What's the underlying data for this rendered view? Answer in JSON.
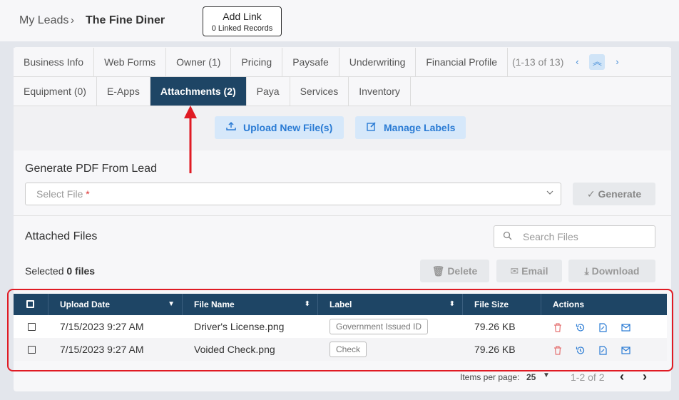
{
  "breadcrumb": {
    "root": "My Leads",
    "separator": "›",
    "current": "The Fine Diner"
  },
  "add_link": {
    "label": "Add Link",
    "sub": "0 Linked Records"
  },
  "tabs_row1": [
    "Business Info",
    "Web Forms",
    "Owner (1)",
    "Pricing",
    "Paysafe",
    "Underwriting",
    "Financial Profile"
  ],
  "tab_pager": {
    "count": "(1-13 of 13)",
    "prev": "‹",
    "collapse": "︽",
    "next": "›"
  },
  "tabs_row2": [
    "Equipment (0)",
    "E-Apps",
    "Attachments (2)",
    "Paya",
    "Services",
    "Inventory"
  ],
  "active_tab": "Attachments (2)",
  "actions": {
    "upload": "Upload New File(s)",
    "manage_labels": "Manage Labels"
  },
  "generate": {
    "title": "Generate PDF From Lead",
    "select_placeholder": "Select File",
    "required_mark": "*",
    "button": "Generate"
  },
  "attached": {
    "title": "Attached Files",
    "search_placeholder": "Search Files",
    "selected_prefix": "Selected",
    "selected_count": "0 files",
    "delete": "Delete",
    "email": "Email",
    "download": "Download"
  },
  "table": {
    "columns": [
      "Upload Date",
      "File Name",
      "Label",
      "File Size",
      "Actions"
    ],
    "rows": [
      {
        "date": "7/15/2023 9:27 AM",
        "name": "Driver's License.png",
        "label": "Government Issued ID",
        "size": "79.26 KB"
      },
      {
        "date": "7/15/2023 9:27 AM",
        "name": "Voided Check.png",
        "label": "Check",
        "size": "79.26 KB"
      }
    ]
  },
  "pagination": {
    "items_label": "Items per page:",
    "items_value": "25",
    "range": "1-2 of 2"
  },
  "colors": {
    "primary": "#1e4565",
    "accent": "#2a7bd4",
    "annotation": "#e01b24"
  }
}
